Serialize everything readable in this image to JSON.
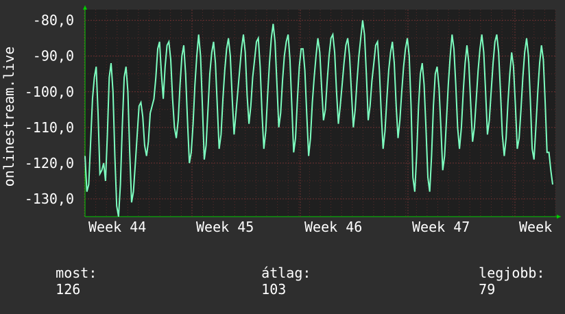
{
  "chart_data": {
    "type": "line",
    "ylabel": "onlinestream.live",
    "ylim": [
      -135,
      -77
    ],
    "yticks": [
      -80,
      -90,
      -100,
      -110,
      -120,
      -130
    ],
    "ytick_labels": [
      "-80,0",
      "-90,0",
      "-100,0",
      "-110,0",
      "-120,0",
      "-130,0"
    ],
    "xtick_labels": [
      "Week 44",
      "Week 45",
      "Week 46",
      "Week 47",
      "Week"
    ],
    "grid": true,
    "colors": {
      "background": "#2e2e2e",
      "plot": "#1f1f1f",
      "line": "#7dffc0",
      "grid": "#5a2a2a",
      "axis": "#00cc00"
    },
    "series": [
      {
        "values": [
          -118,
          -128,
          -126,
          -114,
          -102,
          -96,
          -93,
          -106,
          -123,
          -122,
          -120,
          -125,
          -112,
          -96,
          -92,
          -100,
          -118,
          -132,
          -135,
          -126,
          -110,
          -96,
          -93,
          -100,
          -117,
          -131,
          -128,
          -120,
          -112,
          -104,
          -103,
          -107,
          -115,
          -118,
          -114,
          -106,
          -104,
          -102,
          -96,
          -88,
          -86,
          -95,
          -102,
          -93,
          -87,
          -86,
          -91,
          -102,
          -110,
          -113,
          -108,
          -98,
          -90,
          -87,
          -95,
          -108,
          -120,
          -117,
          -109,
          -98,
          -90,
          -84,
          -90,
          -104,
          -119,
          -115,
          -105,
          -95,
          -89,
          -86,
          -92,
          -104,
          -116,
          -112,
          -102,
          -94,
          -88,
          -85,
          -90,
          -102,
          -112,
          -106,
          -100,
          -94,
          -88,
          -84,
          -89,
          -101,
          -109,
          -104,
          -96,
          -91,
          -86,
          -85,
          -93,
          -106,
          -116,
          -111,
          -101,
          -92,
          -85,
          -81,
          -86,
          -98,
          -110,
          -106,
          -97,
          -90,
          -86,
          -84,
          -91,
          -104,
          -117,
          -113,
          -102,
          -93,
          -88,
          -88,
          -94,
          -106,
          -118,
          -113,
          -103,
          -96,
          -90,
          -85,
          -89,
          -99,
          -108,
          -105,
          -97,
          -90,
          -85,
          -84,
          -89,
          -100,
          -109,
          -104,
          -98,
          -92,
          -87,
          -85,
          -90,
          -100,
          -110,
          -105,
          -97,
          -90,
          -85,
          -80,
          -84,
          -95,
          -108,
          -104,
          -97,
          -92,
          -87,
          -86,
          -94,
          -106,
          -116,
          -111,
          -102,
          -94,
          -89,
          -86,
          -92,
          -104,
          -113,
          -108,
          -100,
          -93,
          -88,
          -85,
          -90,
          -104,
          -124,
          -128,
          -118,
          -104,
          -95,
          -92,
          -98,
          -110,
          -124,
          -128,
          -118,
          -104,
          -95,
          -93,
          -99,
          -110,
          -122,
          -118,
          -108,
          -98,
          -90,
          -84,
          -88,
          -98,
          -110,
          -116,
          -110,
          -100,
          -92,
          -87,
          -92,
          -103,
          -114,
          -110,
          -102,
          -94,
          -88,
          -84,
          -89,
          -100,
          -112,
          -108,
          -100,
          -92,
          -86,
          -84,
          -89,
          -100,
          -112,
          -118,
          -113,
          -103,
          -95,
          -89,
          -93,
          -104,
          -116,
          -113,
          -105,
          -96,
          -89,
          -85,
          -90,
          -102,
          -116,
          -119,
          -110,
          -100,
          -92,
          -87,
          -91,
          -103,
          -117,
          -117,
          -122,
          -126
        ]
      }
    ],
    "footer": {
      "current_label": "most:",
      "current_value": "126",
      "avg_label": "átlag:",
      "avg_value": "103",
      "best_label": "legjobb:",
      "best_value": "79"
    }
  }
}
